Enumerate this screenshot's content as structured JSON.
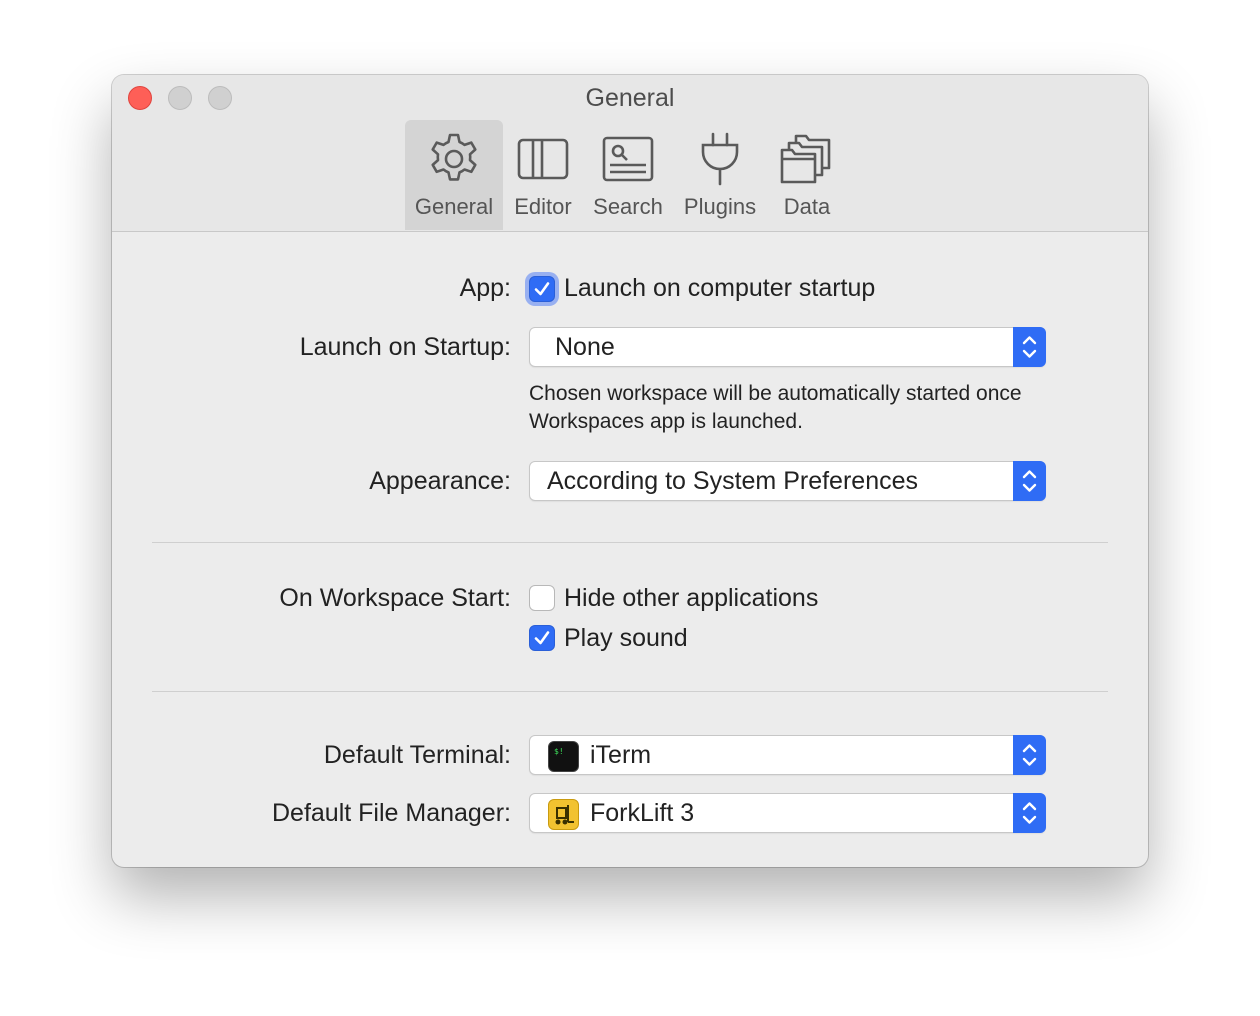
{
  "window": {
    "title": "General"
  },
  "toolbar": {
    "tabs": [
      {
        "label": "General",
        "icon": "gear-icon",
        "selected": true
      },
      {
        "label": "Editor",
        "icon": "columns-icon",
        "selected": false
      },
      {
        "label": "Search",
        "icon": "search-panel-icon",
        "selected": false
      },
      {
        "label": "Plugins",
        "icon": "plug-icon",
        "selected": false
      },
      {
        "label": "Data",
        "icon": "folders-icon",
        "selected": false
      }
    ]
  },
  "app": {
    "label": "App:",
    "launch_checkbox_label": "Launch on computer startup",
    "launch_checked": true
  },
  "launch_on_startup": {
    "label": "Launch on Startup:",
    "value": "None",
    "help_line1": "Chosen workspace will be automatically started once",
    "help_line2": "Workspaces app is launched."
  },
  "appearance": {
    "label": "Appearance:",
    "value": "According to System Preferences"
  },
  "workspace_start": {
    "label": "On Workspace Start:",
    "hide_apps_label": "Hide other applications",
    "hide_apps_checked": false,
    "play_sound_label": "Play sound",
    "play_sound_checked": true
  },
  "default_terminal": {
    "label": "Default Terminal:",
    "value": "iTerm",
    "icon": "iterm-icon"
  },
  "default_file_manager": {
    "label": "Default File Manager:",
    "value": "ForkLift 3",
    "icon": "forklift-icon"
  },
  "colors": {
    "accent": "#2f6cf5",
    "window_bg": "#ececec",
    "close_button": "#fe5f57"
  }
}
